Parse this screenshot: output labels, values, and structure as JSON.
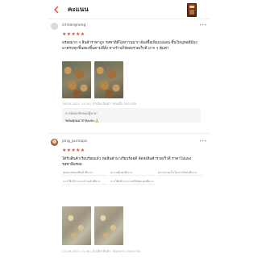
{
  "header": {
    "title": "คะแนน"
  },
  "reviews": [
    {
      "username": "sirinongnong",
      "stars": "★★★★★",
      "text": "อร่อยมาก ๆ สินค้าราคาถูก รสชาติดีไม่หวานมาก ต้องซื้อเพิ่มแน่นอน ชิ้นใหญ่ห่อดีมีถุงมาครบทุกชิ้นสองชิ้นตามที่สั่ง ทางร้านก็จัดส่งรวดเร็วดี มาก ๆ คุ้มค่า",
      "meta": "16-09-2021 14:34 | ตัวเลือกสินค้า: ซองเล็ก 300 กรัม",
      "reply_title": "การตอบกลับของผู้ขาย:",
      "reply_text": "ขอบคุณมากๆนะคะ🙏"
    },
    {
      "username": "ping_purnapa",
      "stars": "★★★★★",
      "text": "ได้รับสินค้าเรียบร้อยแล้ว ห่อสินค้ามาเรียบร้อยดี จัดส่งสินค้ารวดเร็วดี ราคาไม่แพง รสชาติอร่อย",
      "tags": [
        "คุณภาพของสินค้าดีมาก",
        "ความคุ้มค่าดีมาก",
        "ความรวดเร็วในการจัดส่งดีมาก",
        "การให้บริการจากร้านค้าดีมาก",
        "การให้บริการจากบริษัทขนส่งดีมาก"
      ],
      "meta": "17-09-2021 11:46 | ตัวเลือกสินค้า: ซองกลาง 1000 กรัม"
    }
  ]
}
